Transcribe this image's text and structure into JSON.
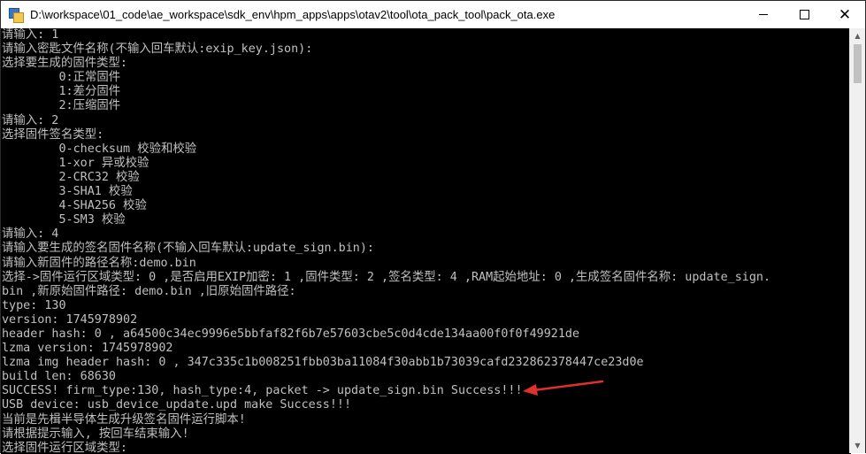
{
  "window": {
    "title": "D:\\workspace\\01_code\\ae_workspace\\sdk_env\\hpm_apps\\apps\\otav2\\tool\\ota_pack_tool\\pack_ota.exe",
    "controls": {
      "minimize": "—",
      "maximize": "☐",
      "close": "✕"
    }
  },
  "console": {
    "lines": [
      "请输入: 1",
      "请输入密匙文件名称(不输入回车默认:exip_key.json):",
      "选择要生成的固件类型:",
      "        0:正常固件",
      "        1:差分固件",
      "        2:压缩固件",
      "请输入: 2",
      "选择固件签名类型:",
      "        0-checksum 校验和校验",
      "        1-xor 异或校验",
      "        2-CRC32 校验",
      "        3-SHA1 校验",
      "        4-SHA256 校验",
      "        5-SM3 校验",
      "请输入: 4",
      "请输入要生成的签名固件名称(不输入回车默认:update_sign.bin):",
      "请输入新固件的路径名称:demo.bin",
      "选择->固件运行区域类型: 0 ,是否启用EXIP加密: 1 ,固件类型: 2 ,签名类型: 4 ,RAM起始地址: 0 ,生成签名固件名称: update_sign.",
      "bin ,新原始固件路径: demo.bin ,旧原始固件路径:",
      "type: 130",
      "version: 1745978902",
      "header hash: 0 , a64500c34ec9996e5bbfaf82f6b7e57603cbe5c0d4cde134aa00f0f0f49921de",
      "lzma version: 1745978902",
      "lzma img header hash: 0 , 347c335c1b008251fbb03ba11084f30abb1b73039cafd232862378447ce23d0e",
      "build len: 68630",
      "SUCCESS! firm_type:130, hash_type:4, packet -> update_sign.bin Success!!!",
      "USB device: usb_device_update.upd make Success!!!",
      "当前是先楫半导体生成升级签名固件运行脚本!",
      "请根据提示输入, 按回车结束输入!",
      "选择固件运行区域类型:"
    ]
  },
  "annotation": {
    "arrow_color": "#e0302b"
  },
  "colors": {
    "console_bg": "#000000",
    "console_text": "#c0c0c0"
  }
}
